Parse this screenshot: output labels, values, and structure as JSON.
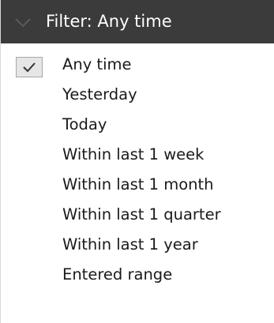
{
  "header": {
    "title": "Filter: Any time",
    "icon": "chevron-down-icon"
  },
  "menu": {
    "selected": "Any time",
    "items": [
      {
        "label": "Any time",
        "checked": true
      },
      {
        "label": "Yesterday",
        "checked": false
      },
      {
        "label": "Today",
        "checked": false
      },
      {
        "label": "Within last 1 week",
        "checked": false
      },
      {
        "label": "Within last 1 month",
        "checked": false
      },
      {
        "label": "Within last 1 quarter",
        "checked": false
      },
      {
        "label": "Within last 1 year",
        "checked": false
      },
      {
        "label": "Entered range",
        "checked": false
      }
    ]
  },
  "colors": {
    "header_bg": "#3b3b3b",
    "header_text": "#ffffff",
    "item_text": "#1a1a1a",
    "check_bg": "#e6e6e6",
    "check_border": "#a8a8a8"
  }
}
